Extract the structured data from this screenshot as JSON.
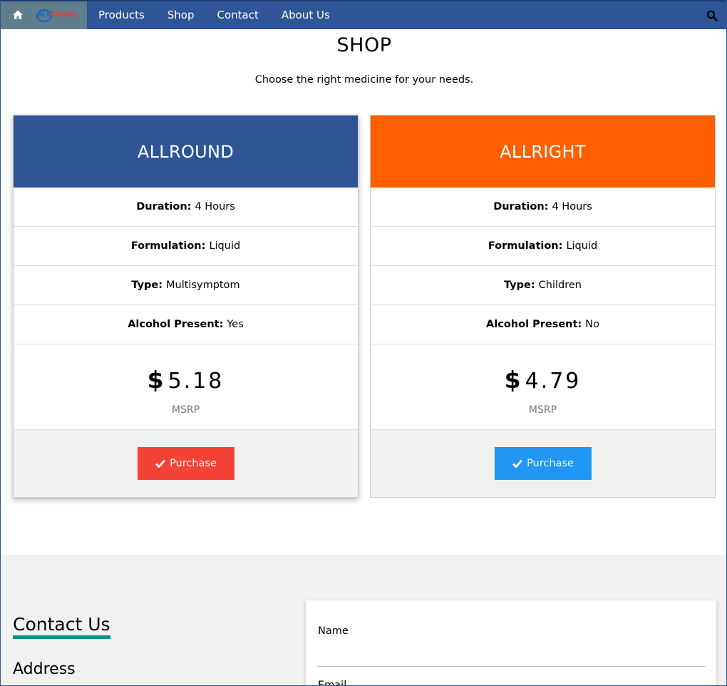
{
  "nav": {
    "logo_part1": "ALL",
    "logo_part2": "ROUND",
    "links": [
      "Products",
      "Shop",
      "Contact",
      "About Us"
    ]
  },
  "shop": {
    "title": "SHOP",
    "subtitle": "Choose the right medicine for your needs."
  },
  "products": [
    {
      "name": "ALLROUND",
      "header_color": "#2f5597",
      "rows": [
        {
          "label": "Duration:",
          "value": "4 Hours"
        },
        {
          "label": "Formulation:",
          "value": "Liquid"
        },
        {
          "label": "Type:",
          "value": "Multisymptom"
        },
        {
          "label": "Alcohol Present:",
          "value": "Yes"
        }
      ],
      "currency": "$",
      "price": "5.18",
      "price_note": "MSRP",
      "button_label": "Purchase",
      "button_color": "#f44336"
    },
    {
      "name": "ALLRIGHT",
      "header_color": "#ff5f00",
      "rows": [
        {
          "label": "Duration:",
          "value": "4 Hours"
        },
        {
          "label": "Formulation:",
          "value": "Liquid"
        },
        {
          "label": "Type:",
          "value": "Children"
        },
        {
          "label": "Alcohol Present:",
          "value": "No"
        }
      ],
      "currency": "$",
      "price": "4.79",
      "price_note": "MSRP",
      "button_label": "Purchase",
      "button_color": "#2196f3"
    }
  ],
  "contact": {
    "title": "Contact Us",
    "address_label": "Address",
    "fields": [
      "Name",
      "Email"
    ]
  },
  "colors": {
    "nav": "#2f5597",
    "nav_home": "#607d8b",
    "accent": "#009688"
  }
}
